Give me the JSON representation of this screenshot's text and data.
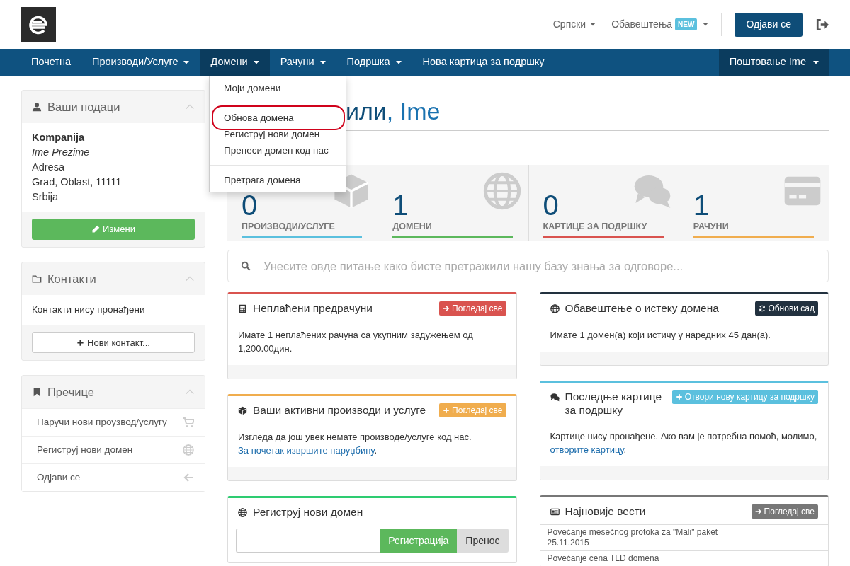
{
  "header": {
    "language": "Српски",
    "notifications": "Обавештења",
    "new_badge": "NEW",
    "logout_button": "Одјави се"
  },
  "nav": {
    "items": [
      {
        "label": "Почетна",
        "caret": false,
        "selected": false
      },
      {
        "label": "Производи/Услуге",
        "caret": true,
        "selected": false
      },
      {
        "label": "Домени",
        "caret": true,
        "selected": true
      },
      {
        "label": "Рачуни",
        "caret": true,
        "selected": false
      },
      {
        "label": "Подршка",
        "caret": true,
        "selected": false
      },
      {
        "label": "Нова картица за подршку",
        "caret": false,
        "selected": false
      }
    ],
    "account": "Поштовање Ime"
  },
  "dropdown": [
    {
      "label": "Моји домени",
      "divider_before": false,
      "highlighted": false
    },
    {
      "label": "Обнова домена",
      "divider_before": true,
      "highlighted": true
    },
    {
      "label": "Региструј нови домен",
      "divider_before": false,
      "highlighted": false
    },
    {
      "label": "Пренеси домен код нас",
      "divider_before": false,
      "highlighted": false
    },
    {
      "label": "Претрага домена",
      "divider_before": true,
      "highlighted": false
    }
  ],
  "sidebar": [
    {
      "kind": "details",
      "title": "Ваши подаци",
      "company": "Kompanija",
      "name": "Ime Prezime",
      "lines": [
        "Adresa",
        "Grad, Oblast, 11111",
        "Srbija"
      ],
      "button": "Измени"
    },
    {
      "kind": "contacts",
      "title": "Контакти",
      "text": "Контакти нису пронађени",
      "button": "Нови контакт..."
    },
    {
      "kind": "shortcuts",
      "title": "Пречице",
      "items": [
        "Наручи нови проузвод/услугу",
        "Региструј нови домен",
        "Одјави се"
      ]
    }
  ],
  "heading": {
    "visible_part": "или",
    "name": ", Ime"
  },
  "stats": [
    {
      "value": "0",
      "label": "ПРОИЗВОДИ/УСЛУГЕ",
      "color": "#5bc0de"
    },
    {
      "value": "1",
      "label": "ДОМЕНИ",
      "color": "#5cb85c"
    },
    {
      "value": "0",
      "label": "КАРТИЦЕ ЗА ПОДРШКУ",
      "color": "#d9534f"
    },
    {
      "value": "1",
      "label": "РАЧУНИ",
      "color": "#f0ad4e"
    }
  ],
  "search": {
    "placeholder": "Унесите овде питање како бисте претражили нашу базу знања за одговоре..."
  },
  "panels": [
    {
      "kind": "text",
      "title": "Неплаћени предрачуни",
      "color": "#d9534f",
      "button": "Погледај све",
      "body": [
        {
          "text": "Имате 1 неплаћених рачуна са укупним задужењем од 1,200.00дин."
        }
      ]
    },
    {
      "kind": "text",
      "title": "Ваши активни производи и услуге",
      "color": "#f0ad4e",
      "button": "Погледај све",
      "body": [
        {
          "text": "Изгледа да још увек немате производе/услуге код нас. "
        },
        {
          "link": "За почетак извршите наруџбину"
        },
        {
          "text": "."
        }
      ]
    },
    {
      "kind": "domain",
      "title": "Региструј нови домен",
      "color": "#2ecc71",
      "register": "Регистрација",
      "transfer": "Пренос"
    },
    {
      "kind": "text",
      "title": "Обавештење о истеку домена",
      "color": "#22313f",
      "button": "Обнови сад",
      "body": [
        {
          "text": "Имате 1 домен(а) који истичу у наредних 45 дан(а)."
        }
      ]
    },
    {
      "kind": "text",
      "title": "Последње картице за подршку",
      "color": "#5bc0de",
      "button": "Отвори нову картицу за подршку",
      "body": [
        {
          "text": "Картице нису пронађене. Ако вам је потребна помоћ, молимо, "
        },
        {
          "link": "отворите картицу"
        },
        {
          "text": "."
        }
      ]
    },
    {
      "kind": "news",
      "title": "Најновије вести",
      "color": "#777777",
      "button": "Погледај све",
      "news": [
        {
          "title": "Povećanje mesečnog protoka za \"Mali\" paket",
          "date": "25.11.2015"
        },
        {
          "title": "Povećanje cena TLD domena"
        }
      ]
    }
  ]
}
